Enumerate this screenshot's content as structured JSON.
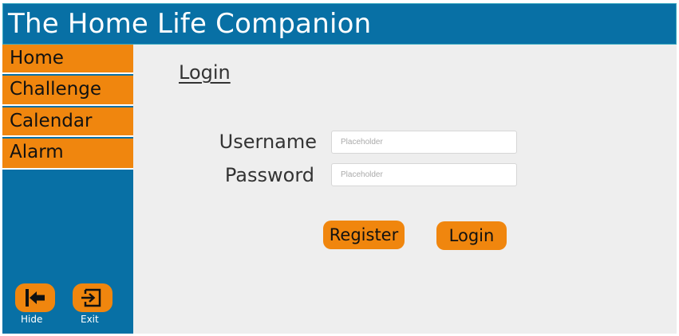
{
  "header": {
    "title": "The Home Life Companion"
  },
  "sidebar": {
    "items": [
      {
        "label": "Home"
      },
      {
        "label": "Challenge"
      },
      {
        "label": "Calendar"
      },
      {
        "label": "Alarm"
      }
    ],
    "hide": {
      "label": "Hide",
      "icon": "arrow-to-bar-left-icon"
    },
    "exit": {
      "label": "Exit",
      "icon": "exit-icon"
    }
  },
  "main": {
    "title": "Login",
    "username": {
      "label": "Username",
      "placeholder": "Placeholder",
      "value": ""
    },
    "password": {
      "label": "Password",
      "placeholder": "Placeholder",
      "value": ""
    },
    "register_label": "Register",
    "login_label": "Login"
  },
  "colors": {
    "header_blue": "#0870a5",
    "accent_orange": "#f0860e",
    "content_bg": "#eeeeee"
  }
}
